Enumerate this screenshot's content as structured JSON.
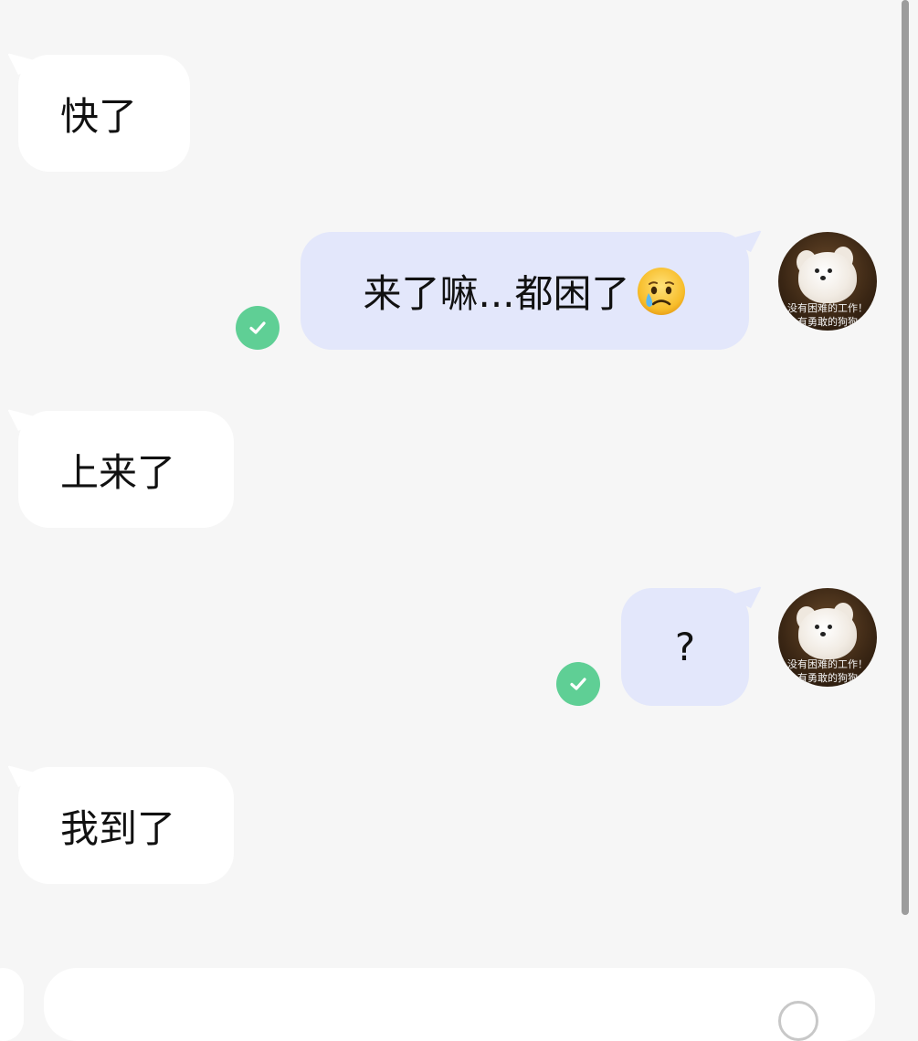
{
  "messages": [
    {
      "id": "m1",
      "direction": "incoming",
      "text": "快了"
    },
    {
      "id": "m2",
      "direction": "outgoing",
      "text": "来了嘛...都困了",
      "emoji": "crying-face",
      "status": "delivered"
    },
    {
      "id": "m3",
      "direction": "incoming",
      "text": "上来了"
    },
    {
      "id": "m4",
      "direction": "outgoing",
      "text": "?",
      "status": "delivered"
    },
    {
      "id": "m5",
      "direction": "incoming",
      "text": "我到了"
    }
  ],
  "avatar": {
    "caption_line1": "没有困难的工作！",
    "caption_line2": "有勇敢的狗狗"
  },
  "colors": {
    "background": "#f6f6f6",
    "incoming_bubble": "#ffffff",
    "outgoing_bubble": "#e3e7fb",
    "check": "#5fcf95"
  }
}
